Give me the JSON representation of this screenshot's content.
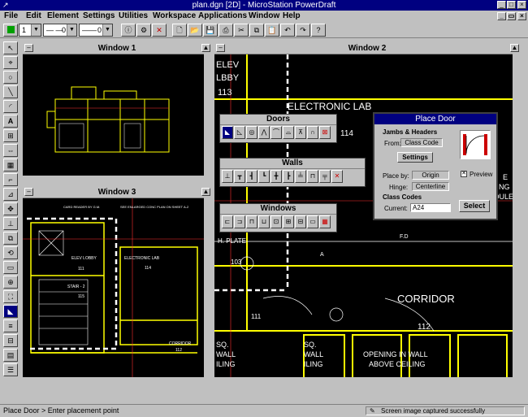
{
  "window": {
    "title": "plan.dgn [2D] - MicroStation PowerDraft"
  },
  "menu": [
    "File",
    "Edit",
    "Element",
    "Settings",
    "Utilities",
    "Workspace",
    "Applications",
    "Window",
    "Help"
  ],
  "toolbar": {
    "level": "1",
    "color": "0",
    "weight": "0"
  },
  "views": {
    "w1": {
      "title": "Window 1"
    },
    "w2": {
      "title": "Window 2"
    },
    "w3": {
      "title": "Window 3"
    }
  },
  "palettes": {
    "doors": "Doors",
    "walls": "Walls",
    "windows": "Windows"
  },
  "dialog": {
    "title": "Place Door",
    "jambs_label": "Jambs & Headers",
    "from_label": "From:",
    "from_value": "Class Code",
    "settings_label": "Settings",
    "preview_label": "Preview",
    "place_by_label": "Place by:",
    "place_by_value": "Origin",
    "hinge_label": "Hinge:",
    "hinge_value": "Centerline",
    "class_codes_label": "Class Codes",
    "current_label": "Current:",
    "current_value": "A24",
    "select_label": "Select"
  },
  "drawing_text": {
    "w1": [],
    "w3": [
      "CARD READER BY G.M.",
      "SEE ENLARGED CONC PLAN ON SHEET A-2",
      "ELEV LOBBY",
      "111",
      "STAIR - 2",
      "115",
      "ELECTRONIC LAB",
      "114",
      "CORRIDOR",
      "112"
    ],
    "w2": [
      "ELEV",
      "LBBY",
      "113",
      "ELECTRONIC LAB",
      "114",
      "H. PLATE",
      "F.D",
      "A",
      "103",
      "111",
      "CORRIDOR",
      "112",
      "SQ.",
      "WALL",
      "ILING",
      "OPENING IN WALL",
      "ABOVE CEILING",
      "SQ.",
      "WALL",
      "ILING",
      "E",
      "NG",
      "DULE"
    ]
  },
  "status": {
    "left": "Place Door > Enter placement point",
    "right": "Screen image captured successfully"
  },
  "colors": {
    "titlebar": "#000080",
    "face": "#c0c0c0",
    "canvas": "#000000",
    "lines": "#ffff00"
  }
}
